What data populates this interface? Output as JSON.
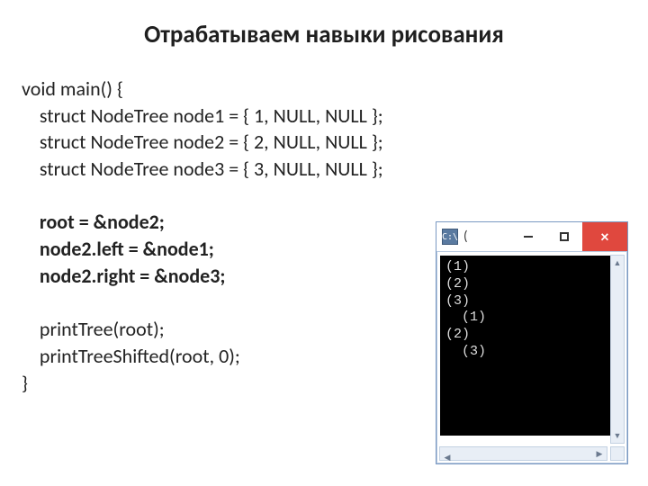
{
  "title": "Отрабатываем навыки рисования",
  "code": {
    "l1": "void main() {",
    "l2": "    struct NodeTree node1 = { 1, NULL, NULL };",
    "l3": "    struct NodeTree node2 = { 2, NULL, NULL };",
    "l4": "    struct NodeTree node3 = { 3, NULL, NULL };",
    "l5": "",
    "l6": "    root = &node2;",
    "l7": "    node2.left = &node1;",
    "l8": "    node2.right = &node3;",
    "l9": "",
    "l10": "    printTree(root);",
    "l11": "    printTreeShifted(root, 0);",
    "l12": "}"
  },
  "console": {
    "icon_glyph": "C:\\",
    "title_text": "(",
    "close_glyph": "×",
    "output": "(1)\n(2)\n(3)\n  (1)\n(2)\n  (3)"
  }
}
